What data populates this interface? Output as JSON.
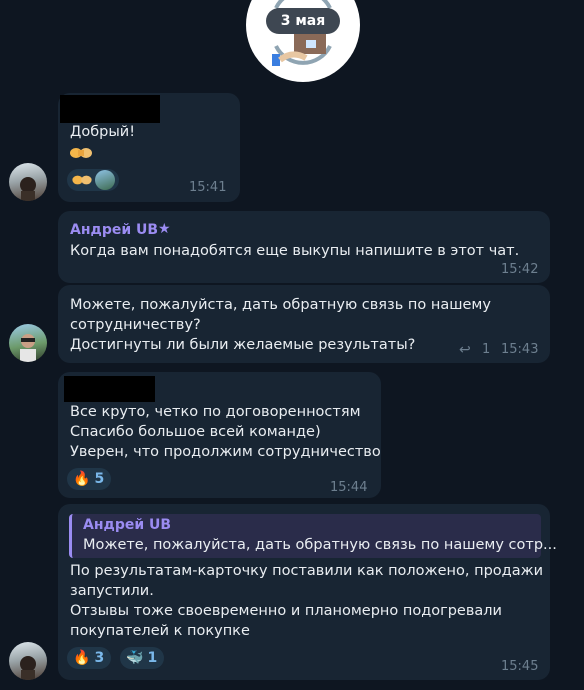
{
  "date_badge": "3 мая",
  "messages": [
    {
      "text": "Добрый!",
      "time": "15:41"
    },
    {
      "sender": "Андрей UB",
      "text": "Когда вам понадобятся еще выкупы напишите в этот чат.",
      "time": "15:42"
    },
    {
      "text": "Можете, пожалуйста, дать обратную связь по нашему\nсотрудничеству?\nДостигнуты ли были желаемые результаты?",
      "reply_count": "1",
      "time": "15:43"
    },
    {
      "text": "Все круто, четко по договоренностям\nСпасибо большое всей команде)\nУверен, что продолжим сотрудничество",
      "reaction_fire_count": "5",
      "time": "15:44"
    },
    {
      "quote_sender": "Андрей UB",
      "quote_text": "Можете, пожалуйста, дать обратную связь по нашему сотр...",
      "text": "По результатам-карточку поставили как положено, продажи\nзапустили.\nОтзывы тоже своевременно и планомерно подогревали\nпокупателей к покупке",
      "reaction_fire_count": "3",
      "reaction_whale_count": "1",
      "time": "15:45"
    }
  ],
  "colors": {
    "background": "#0e1621",
    "bubble": "#182533",
    "sender_name": "#9b8cf2",
    "time": "#6d7f8f",
    "reaction_count": "#7ab8ea"
  }
}
